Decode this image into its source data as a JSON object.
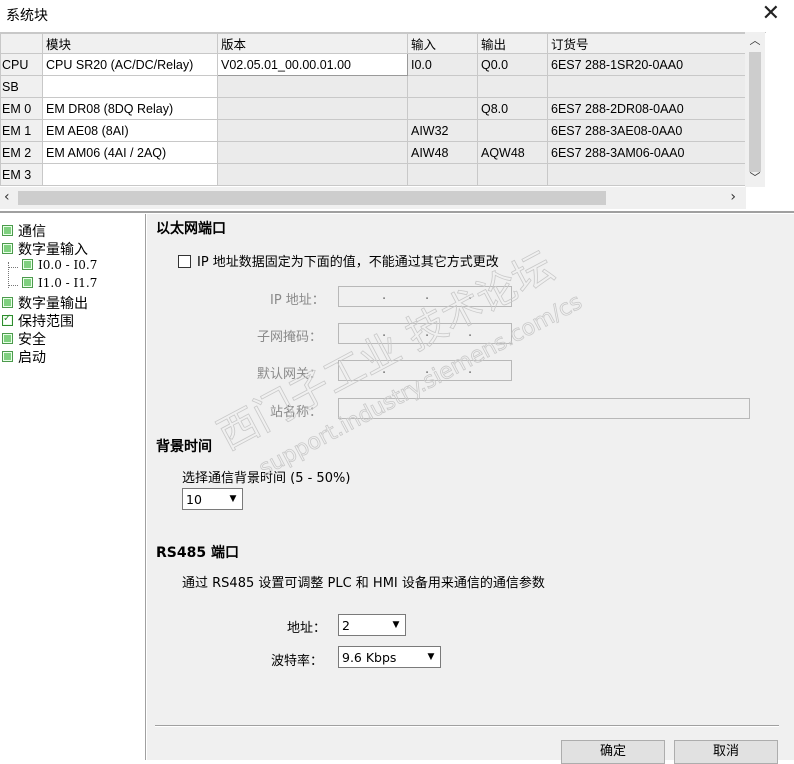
{
  "window": {
    "title": "系统块",
    "close_glyph": "✕"
  },
  "grid": {
    "headers": [
      "",
      "模块",
      "版本",
      "输入",
      "输出",
      "订货号"
    ],
    "rows": [
      {
        "slot": "CPU",
        "module": "CPU SR20 (AC/DC/Relay)",
        "version": "V02.05.01_00.00.01.00",
        "input": "I0.0",
        "output": "Q0.0",
        "order": "6ES7 288-1SR20-0AA0"
      },
      {
        "slot": "SB",
        "module": "",
        "version": "",
        "input": "",
        "output": "",
        "order": ""
      },
      {
        "slot": "EM 0",
        "module": "EM DR08 (8DQ Relay)",
        "version": "",
        "input": "",
        "output": "Q8.0",
        "order": "6ES7 288-2DR08-0AA0"
      },
      {
        "slot": "EM 1",
        "module": "EM AE08 (8AI)",
        "version": "",
        "input": "AIW32",
        "output": "",
        "order": "6ES7 288-3AE08-0AA0"
      },
      {
        "slot": "EM 2",
        "module": "EM AM06 (4AI / 2AQ)",
        "version": "",
        "input": "AIW48",
        "output": "AQW48",
        "order": "6ES7 288-3AM06-0AA0"
      },
      {
        "slot": "EM 3",
        "module": "",
        "version": "",
        "input": "",
        "output": "",
        "order": ""
      }
    ]
  },
  "tree": {
    "communication": "通信",
    "digital_input": "数字量输入",
    "di_range_1": "I0.0 - I0.7",
    "di_range_2": "I1.0 - I1.7",
    "digital_output": "数字量输出",
    "retentive": "保持范围",
    "security": "安全",
    "startup": "启动"
  },
  "ethernet": {
    "heading": "以太网端口",
    "fixed_ip_label": "IP 地址数据固定为下面的值，不能通过其它方式更改",
    "ip_label": "IP 地址：",
    "subnet_label": "子网掩码：",
    "gateway_label": "默认网关：",
    "station_label": "站名称："
  },
  "background": {
    "heading": "背景时间",
    "select_label": "选择通信背景时间 (5 - 50%)",
    "value": "10"
  },
  "rs485": {
    "heading": "RS485 端口",
    "description": "通过 RS485 设置可调整 PLC 和 HMI 设备用来通信的通信参数",
    "address_label": "地址：",
    "address_value": "2",
    "baud_label": "波特率：",
    "baud_value": "9.6 Kbps"
  },
  "buttons": {
    "ok": "确定",
    "cancel": "取消"
  },
  "watermark": {
    "line1": "西门子工业  技术论坛",
    "line2": "support.industry.siemens.com/cs"
  }
}
